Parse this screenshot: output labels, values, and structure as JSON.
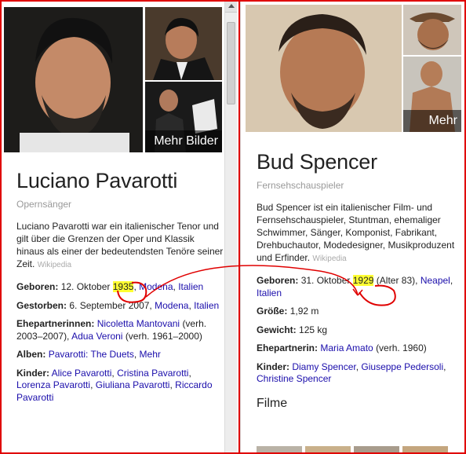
{
  "left": {
    "more_images": "Mehr Bilder",
    "name": "Luciano Pavarotti",
    "subtitle": "Opernsänger",
    "description": "Luciano Pavarotti war ein italienischer Tenor und gilt über die Grenzen der Oper und Klassik hinaus als einer der bedeutendsten Tenöre seiner Zeit.",
    "source": "Wikipedia",
    "born": {
      "label": "Geboren:",
      "date": "12. Oktober",
      "year": "1935",
      "sep": ",",
      "place1": "Modena",
      "comma": ",",
      "place2": "Italien"
    },
    "died": {
      "label": "Gestorben:",
      "date": "6. September 2007,",
      "place1": "Modena",
      "comma": ",",
      "place2": "Italien"
    },
    "partners": {
      "label": "Ehepartnerinnen:",
      "p1": "Nicoletta Mantovani",
      "p1_note": "(verh. 2003–2007),",
      "p2": "Adua Veroni",
      "p2_note": "(verh. 1961–2000)"
    },
    "albums": {
      "label": "Alben:",
      "a1": "Pavarotti: The Duets",
      "comma": ",",
      "more": "Mehr"
    },
    "children": {
      "label": "Kinder:",
      "c1": "Alice Pavarotti",
      "c2": "Cristina Pavarotti",
      "c3": "Lorenza Pavarotti",
      "c4": "Giuliana Pavarotti",
      "c5": "Riccardo Pavarotti",
      "sep": ","
    }
  },
  "right": {
    "more_images": "Mehr Bilder",
    "name": "Bud Spencer",
    "subtitle": "Fernsehschauspieler",
    "description": "Bud Spencer ist ein italienischer Film- und Fernsehschauspieler, Stuntman, ehemaliger Schwimmer, Sänger, Komponist, Fabrikant, Drehbuchautor, Modedesigner, Musikproduzent und Erfinder.",
    "source": "Wikipedia",
    "born": {
      "label": "Geboren:",
      "date": "31. Oktober",
      "year": "1929",
      "age": "(Alter 83),",
      "place1": "Neapel",
      "comma": ",",
      "place2": "Italien"
    },
    "height": {
      "label": "Größe:",
      "value": "1,92 m"
    },
    "weight": {
      "label": "Gewicht:",
      "value": "125 kg"
    },
    "partner": {
      "label": "Ehepartnerin:",
      "p1": "Maria Amato",
      "p1_note": "(verh. 1960)"
    },
    "children": {
      "label": "Kinder:",
      "c1": "Diamy Spencer",
      "c2": "Giuseppe Pedersoli",
      "c3": "Christine Spencer",
      "sep": ","
    },
    "films_heading": "Filme"
  },
  "colors": {
    "link": "#1a0dab",
    "highlight": "#ffff33",
    "annotation": "#e00000"
  }
}
